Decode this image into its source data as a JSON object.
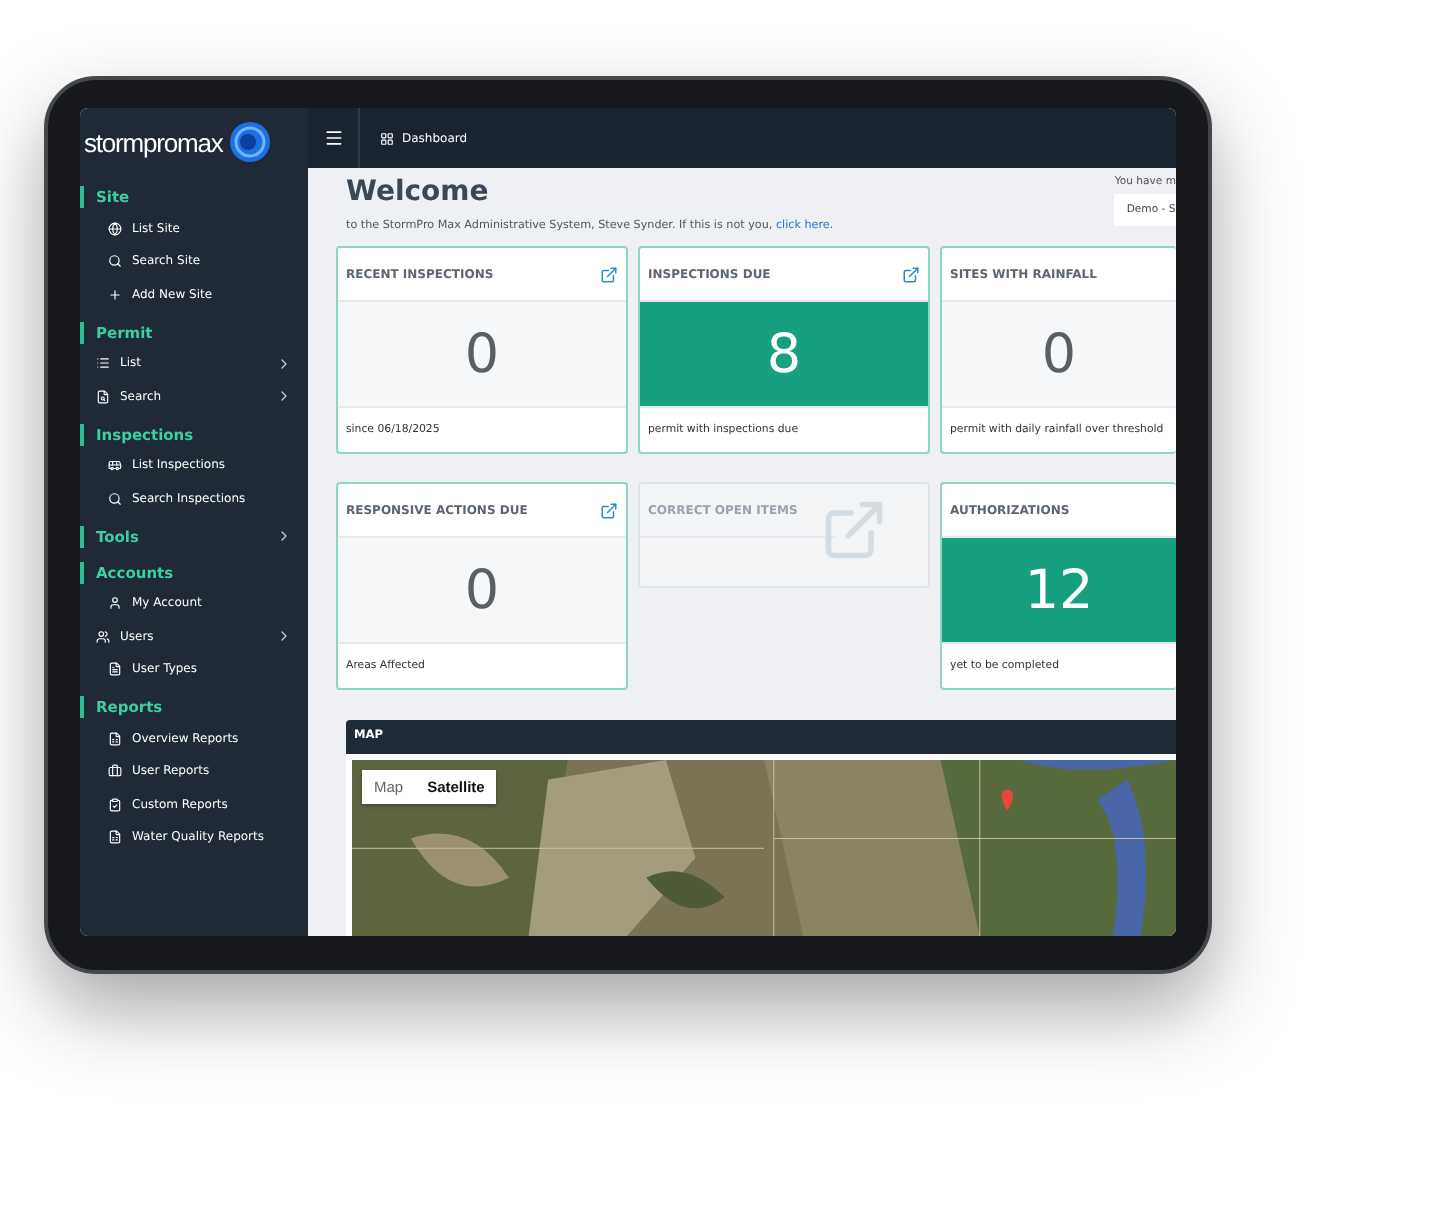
{
  "sidebar": {
    "logo": "stormpromax",
    "sections": [
      {
        "title": "Site",
        "expandable": false,
        "items": [
          {
            "label": "List Site",
            "expandable": false
          },
          {
            "label": "Search Site",
            "expandable": false
          },
          {
            "label": "Add New Site",
            "expandable": false
          }
        ]
      },
      {
        "title": "Permit",
        "expandable": false,
        "items": [
          {
            "label": "List",
            "expandable": true
          },
          {
            "label": "Search",
            "expandable": true
          }
        ]
      },
      {
        "title": "Inspections",
        "expandable": false,
        "items": [
          {
            "label": "List Inspections",
            "expandable": false
          },
          {
            "label": "Search Inspections",
            "expandable": false
          }
        ]
      },
      {
        "title": "Tools",
        "expandable": true
      },
      {
        "title": "Accounts",
        "expandable": false,
        "items": [
          {
            "label": "My Account",
            "expandable": false
          },
          {
            "label": "Users",
            "expandable": true
          },
          {
            "label": "User Types",
            "expandable": false
          }
        ]
      },
      {
        "title": "Reports",
        "expandable": false,
        "items": [
          {
            "label": "Overview Reports",
            "expandable": false
          },
          {
            "label": "User Reports",
            "expandable": false
          },
          {
            "label": "Custom Reports",
            "expandable": false
          },
          {
            "label": "Water Quality Reports",
            "expandable": false
          }
        ]
      }
    ]
  },
  "topbar": {
    "breadcrumb": "Dashboard"
  },
  "welcome": {
    "title": "Welcome",
    "message": "to the StormPro Max Administrative System, Steve Synder. If this is not you,",
    "link": "click here.",
    "notice": "You have m",
    "account_select": "Demo - S"
  },
  "cards": [
    {
      "kind": "plain",
      "title": "RECENT INSPECTIONS",
      "value": "0",
      "footer": "since 06/18/2025",
      "popout": true
    },
    {
      "kind": "highlight",
      "title": "INSPECTIONS DUE",
      "value": "8",
      "footer": "permit with inspections due",
      "popout": true
    },
    {
      "kind": "plain",
      "title": "SITES WITH RAINFALL",
      "value": "0",
      "footer": "permit with daily rainfall over threshold",
      "popout": false
    },
    {
      "kind": "plain",
      "title": "RESPONSIVE ACTIONS DUE",
      "value": "0",
      "footer": "Areas Affected",
      "popout": true
    },
    {
      "kind": "disabled",
      "title": "CORRECT OPEN ITEMS",
      "popout": true
    },
    {
      "kind": "highlight",
      "title": "AUTHORIZATIONS",
      "value": "12",
      "footer": "yet to be completed",
      "popout": false
    }
  ],
  "map": {
    "title": "MAP",
    "view_tabs": [
      {
        "label": "Map",
        "selected": false
      },
      {
        "label": "Satellite",
        "selected": true
      }
    ]
  }
}
